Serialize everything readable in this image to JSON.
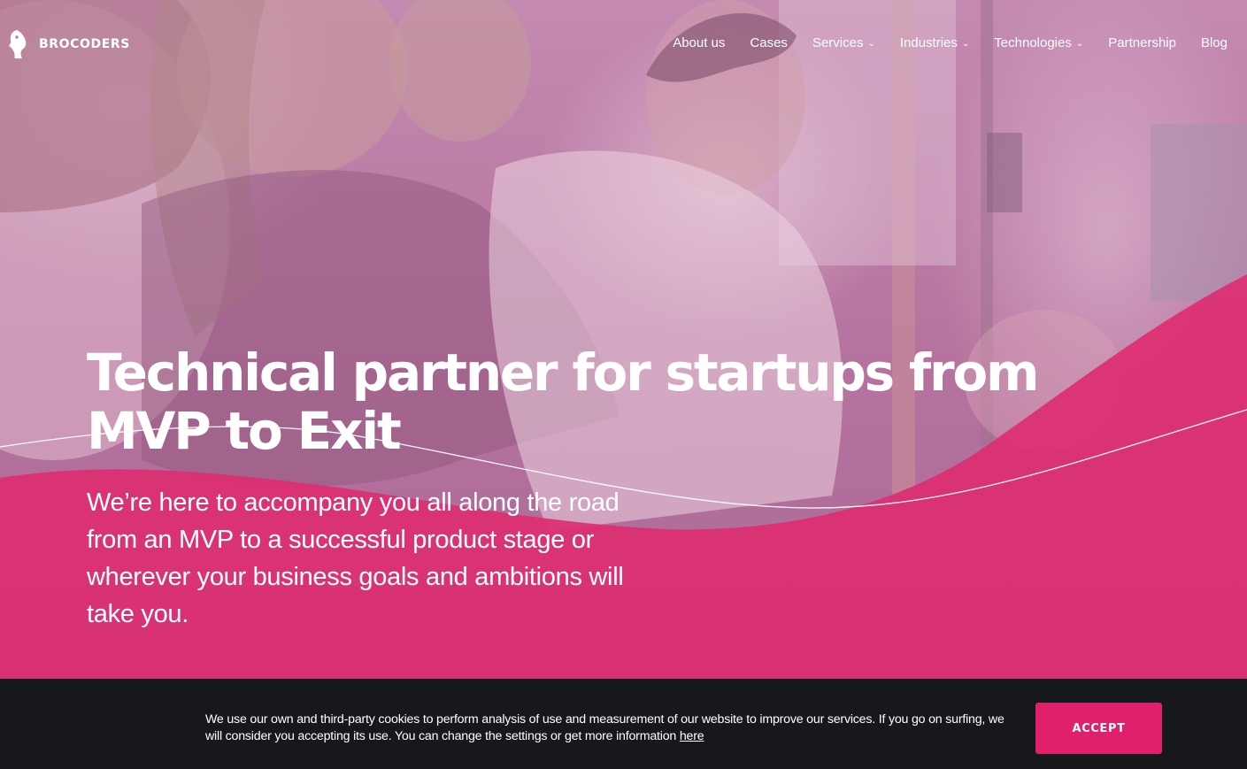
{
  "brand": {
    "name": "BROCODERS"
  },
  "nav": {
    "items": [
      {
        "label": "About us",
        "dropdown": false
      },
      {
        "label": "Cases",
        "dropdown": false
      },
      {
        "label": "Services",
        "dropdown": true
      },
      {
        "label": "Industries",
        "dropdown": true
      },
      {
        "label": "Technologies",
        "dropdown": true
      },
      {
        "label": "Partnership",
        "dropdown": false
      },
      {
        "label": "Blog",
        "dropdown": false
      }
    ]
  },
  "hero": {
    "title": "Technical partner for startups from MVP to Exit",
    "subtitle": "We’re here to accompany you all along the road from an MVP to a successful product stage or wherever your business goals and ambitions will take you."
  },
  "cookie": {
    "text": "We use our own and third-party cookies to perform analysis of use and measurement of our website to improve our services. If you go on surfing, we will consider you accepting its use. You can change the settings or get more information ",
    "link_label": "here",
    "accept_label": "ACCEPT"
  },
  "icons": {
    "logo": "brocoders-logo-icon",
    "dropdown": "chevron-down-icon"
  },
  "colors": {
    "accent": "#e0206b",
    "hero_tint": "#b97aa5",
    "cookie_bg": "#16181c",
    "text_light": "#ffffff"
  }
}
